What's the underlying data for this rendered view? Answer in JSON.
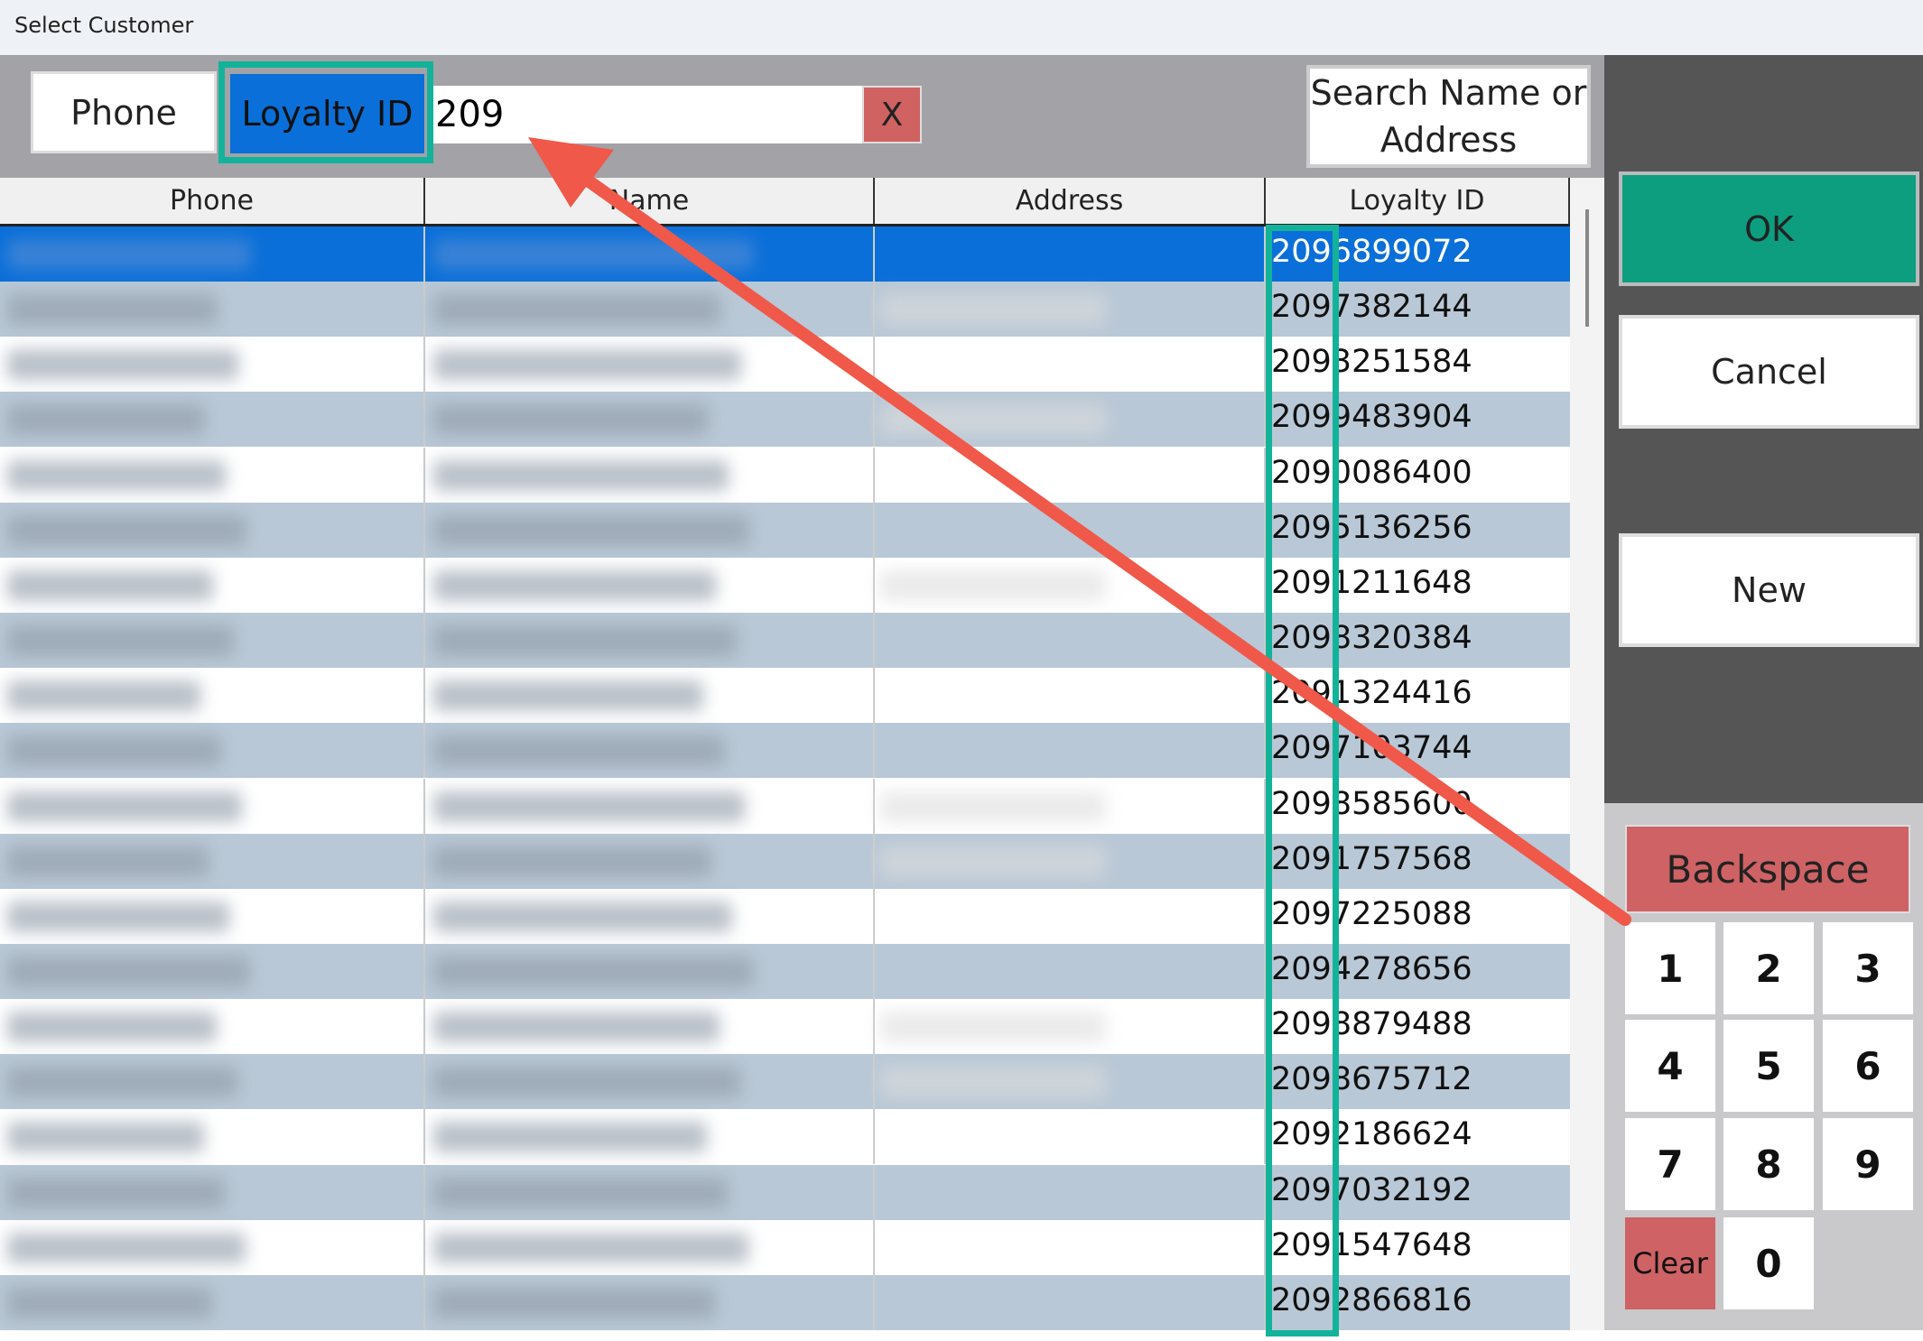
{
  "window": {
    "title": "Select Customer"
  },
  "toolbar": {
    "phone_label": "Phone",
    "loyalty_label": "Loyalty ID",
    "search_value": "209",
    "clear_label": "X",
    "name_search_label": "Search Name or Address"
  },
  "table": {
    "columns": [
      "Phone",
      "Name",
      "Address",
      "Loyalty ID"
    ],
    "loyalty_ids": [
      "2096899072",
      "2097382144",
      "2093251584",
      "2099483904",
      "2090086400",
      "2095136256",
      "2091211648",
      "2098320384",
      "2091324416",
      "2097103744",
      "2098585600",
      "2091757568",
      "2097225088",
      "2094278656",
      "2098879488",
      "2098675712",
      "2092186624",
      "2097032192",
      "2091547648",
      "2092866816"
    ],
    "selected_row": 0
  },
  "actions": {
    "ok": "OK",
    "cancel": "Cancel",
    "new": "New"
  },
  "keypad": {
    "backspace": "Backspace",
    "keys": [
      "1",
      "2",
      "3",
      "4",
      "5",
      "6",
      "7",
      "8",
      "9"
    ],
    "clear": "Clear",
    "zero": "0"
  },
  "colors": {
    "selected_row": "#0a6fd8",
    "alt_row": "#b9c8d6",
    "ok": "#0c9e7f",
    "danger": "#cf6264",
    "highlight": "#12b39a",
    "arrow": "#f0584a"
  },
  "annotation_icons": [
    "red-arrow-icon",
    "highlight-box"
  ]
}
